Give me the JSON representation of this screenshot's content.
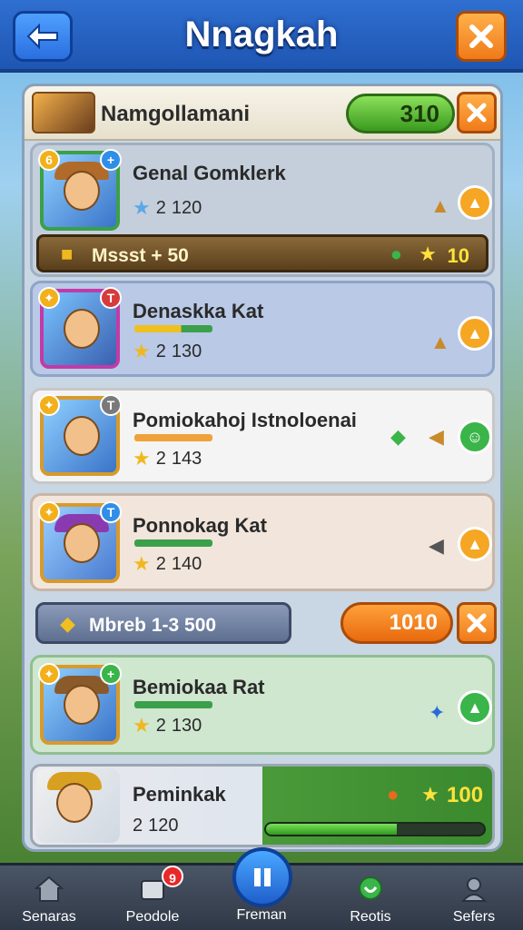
{
  "header": {
    "title": "Nnagkah"
  },
  "panel": {
    "title": "Namgollamani",
    "score": "310"
  },
  "cards": [
    {
      "name": "Genal Gomklerk",
      "level": "2",
      "value": "120",
      "reward_label": "Mssst + 50",
      "reward_value": "10",
      "stat_label_tl": "6",
      "stat_label_tr": "+"
    },
    {
      "name": "Denaskka Kat",
      "level": "2",
      "value": "130",
      "stat_label_tl": "✦",
      "stat_label_tr": "T"
    },
    {
      "name": "Pomiokahoj Istnoloenai",
      "level": "2",
      "value": "143",
      "stat_label_tl": "✦",
      "stat_label_tr": "T"
    },
    {
      "name": "Ponnokag Kat",
      "level": "2",
      "value": "140",
      "stat_label_tl": "✦",
      "stat_label_tr": "T"
    }
  ],
  "mid_strip": {
    "label": "Mbreb 1-3 500",
    "value": "1010"
  },
  "cards2": [
    {
      "name": "Bemiokaa Rat",
      "level": "2",
      "value": "130",
      "stat_label_tl": "✦",
      "stat_label_tr": "+"
    },
    {
      "name": "Peminkak",
      "level": "2",
      "value": "120",
      "reward_value": "100",
      "progress": 0.6
    }
  ],
  "bottom_nav": {
    "items": [
      {
        "label": "Senaras"
      },
      {
        "label": "Peodole",
        "badge": "9"
      },
      {
        "label": "Freman"
      },
      {
        "label": "Reotis"
      },
      {
        "label": "Sefers"
      }
    ]
  },
  "colors": {
    "accent": "#2f6fd0",
    "orange": "#f07a1a",
    "green": "#3a9a1e"
  }
}
